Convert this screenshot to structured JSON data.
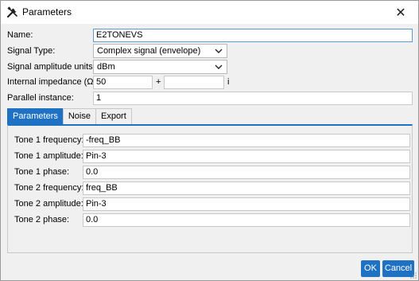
{
  "window": {
    "title": "Parameters",
    "app_icon": "tools-icon",
    "close_glyph": "✕"
  },
  "form": {
    "name": {
      "label": "Name:",
      "value": "E2TONEVS"
    },
    "signal_type": {
      "label": "Signal Type:",
      "value": "Complex signal (envelope)"
    },
    "amplitude_units": {
      "label": "Signal amplitude units:",
      "value": "dBm"
    },
    "impedance": {
      "label": "Internal impedance (Ω):",
      "real": "50",
      "plus": "+",
      "imag": "",
      "imag_suffix": "i"
    },
    "parallel": {
      "label": "Parallel instance:",
      "value": "1"
    }
  },
  "tabs": [
    {
      "label": "Parameters",
      "active": true
    },
    {
      "label": "Noise",
      "active": false
    },
    {
      "label": "Export",
      "active": false
    }
  ],
  "parameters": [
    {
      "label": "Tone 1 frequency:",
      "value": "-freq_BB"
    },
    {
      "label": "Tone 1 amplitude:",
      "value": "Pin-3"
    },
    {
      "label": "Tone 1 phase:",
      "value": "0.0"
    },
    {
      "label": "Tone 2 frequency:",
      "value": "freq_BB"
    },
    {
      "label": "Tone 2 amplitude:",
      "value": "Pin-3"
    },
    {
      "label": "Tone 2 phase:",
      "value": "0.0"
    }
  ],
  "buttons": {
    "ok": "OK",
    "cancel": "Cancel"
  },
  "colors": {
    "accent": "#1f71c4",
    "window_bg": "#f0f0f0",
    "border": "#c8c8c8"
  }
}
